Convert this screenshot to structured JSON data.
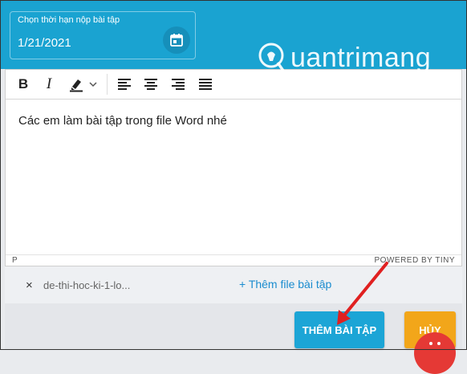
{
  "deadline": {
    "label": "Chọn thời hạn nộp bài tập",
    "value": "1/21/2021",
    "calendar_icon": "calendar-icon"
  },
  "watermark": {
    "text": "uantrimang",
    "icon": "lightbulb-q-logo"
  },
  "toolbar": {
    "bold": "B",
    "italic": "I",
    "highlight_icon": "highlighter-icon",
    "dropdown_icon": "chevron-down-icon",
    "align_icons": [
      "align-left-icon",
      "align-center-icon",
      "align-right-icon",
      "align-justify-icon"
    ]
  },
  "editor": {
    "content": "Các em làm bài tập trong file Word nhé",
    "status_path": "P",
    "status_brand": "POWERED BY TINY"
  },
  "attachments": {
    "file_name": "de-thi-hoc-ki-1-lo...",
    "remove_label": "×",
    "add_label": "+ Thêm file bài tập"
  },
  "footer": {
    "submit_label": "THÊM BÀI TẬP",
    "cancel_label": "HỦY"
  },
  "colors": {
    "accent": "#1aa3d1",
    "submit": "#1ca5d6",
    "cancel": "#f2a61a",
    "fab": "#e53935",
    "annotation_arrow": "#e02020"
  }
}
